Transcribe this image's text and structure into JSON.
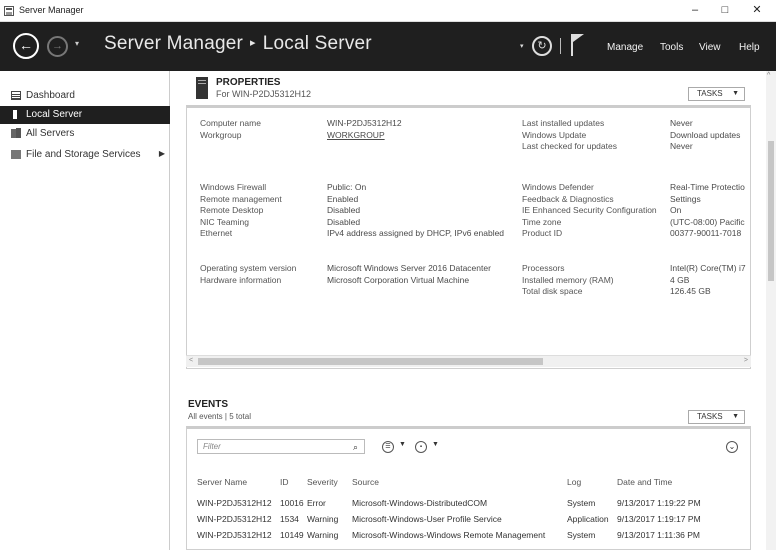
{
  "window": {
    "title": "Server Manager",
    "minimize": "–",
    "maximize": "□",
    "close": "✕"
  },
  "header": {
    "app_name": "Server Manager",
    "separator": "▸",
    "page": "Local Server",
    "back_glyph": "←",
    "forward_glyph": "→",
    "dropdown_glyph": "▾",
    "refresh_glyph": "↻",
    "menu": [
      "Manage",
      "Tools",
      "View",
      "Help"
    ]
  },
  "sidebar": {
    "items": [
      {
        "label": "Dashboard",
        "icon": "dashboard-icon",
        "active": false
      },
      {
        "label": "Local Server",
        "icon": "server-icon",
        "active": true
      },
      {
        "label": "All Servers",
        "icon": "servers-icon",
        "active": false
      },
      {
        "label": "File and Storage Services",
        "icon": "storage-icon",
        "active": false,
        "arrow": "▶"
      }
    ]
  },
  "properties": {
    "title": "PROPERTIES",
    "subtitle": "For WIN-P2DJ5312H12",
    "tasks_label": "TASKS",
    "caret": "▼",
    "left_groups": [
      [
        [
          "Computer name",
          "WIN-P2DJ5312H12"
        ],
        [
          "Workgroup",
          "WORKGROUP"
        ]
      ],
      [
        [
          "Windows Firewall",
          "Public: On"
        ],
        [
          "Remote management",
          "Enabled"
        ],
        [
          "Remote Desktop",
          "Disabled"
        ],
        [
          "NIC Teaming",
          "Disabled"
        ],
        [
          "Ethernet",
          "IPv4 address assigned by DHCP, IPv6 enabled"
        ]
      ],
      [
        [
          "Operating system version",
          "Microsoft Windows Server 2016 Datacenter"
        ],
        [
          "Hardware information",
          "Microsoft Corporation Virtual Machine"
        ]
      ]
    ],
    "right_groups": [
      [
        [
          "Last installed updates",
          "Never"
        ],
        [
          "Windows Update",
          "Download updates"
        ],
        [
          "Last checked for updates",
          "Never"
        ]
      ],
      [
        [
          "Windows Defender",
          "Real-Time Protectio"
        ],
        [
          "Feedback & Diagnostics",
          "Settings"
        ],
        [
          "IE Enhanced Security Configuration",
          "On"
        ],
        [
          "Time zone",
          "(UTC-08:00) Pacific"
        ],
        [
          "Product ID",
          "00377-90011-7018"
        ]
      ],
      [
        [
          "Processors",
          "Intel(R) Core(TM) i7"
        ],
        [
          "Installed memory (RAM)",
          "4 GB"
        ],
        [
          "Total disk space",
          "126.45 GB"
        ]
      ]
    ]
  },
  "events": {
    "title": "EVENTS",
    "subtitle": "All events | 5 total",
    "tasks_label": "TASKS",
    "caret": "▼",
    "filter_placeholder": "Filter",
    "columns": [
      "Server Name",
      "ID",
      "Severity",
      "Source",
      "Log",
      "Date and Time"
    ],
    "rows": [
      [
        "WIN-P2DJ5312H12",
        "10016",
        "Error",
        "Microsoft-Windows-DistributedCOM",
        "System",
        "9/13/2017 1:19:22 PM"
      ],
      [
        "WIN-P2DJ5312H12",
        "1534",
        "Warning",
        "Microsoft-Windows-User Profile Service",
        "Application",
        "9/13/2017 1:19:17 PM"
      ],
      [
        "WIN-P2DJ5312H12",
        "10149",
        "Warning",
        "Microsoft-Windows-Windows Remote Management",
        "System",
        "9/13/2017 1:11:36 PM"
      ]
    ]
  }
}
